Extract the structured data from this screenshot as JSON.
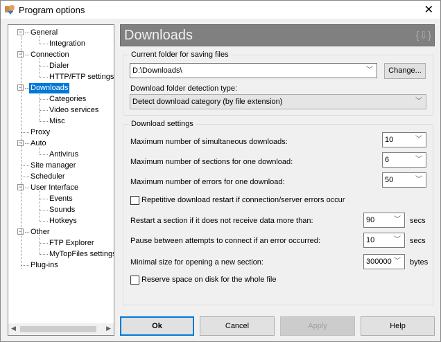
{
  "window": {
    "title": "Program options",
    "close": "✕"
  },
  "tree": [
    {
      "label": "General",
      "level": 0,
      "expander": "−"
    },
    {
      "label": "Integration",
      "level": 1
    },
    {
      "label": "Connection",
      "level": 0,
      "expander": "−"
    },
    {
      "label": "Dialer",
      "level": 1
    },
    {
      "label": "HTTP/FTP settings",
      "level": 1
    },
    {
      "label": "Downloads",
      "level": 0,
      "expander": "−",
      "selected": true
    },
    {
      "label": "Categories",
      "level": 1
    },
    {
      "label": "Video services",
      "level": 1
    },
    {
      "label": "Misc",
      "level": 1
    },
    {
      "label": "Proxy",
      "level": 0
    },
    {
      "label": "Auto",
      "level": 0,
      "expander": "−"
    },
    {
      "label": "Antivirus",
      "level": 1
    },
    {
      "label": "Site manager",
      "level": 0
    },
    {
      "label": "Scheduler",
      "level": 0
    },
    {
      "label": "User Interface",
      "level": 0,
      "expander": "−"
    },
    {
      "label": "Events",
      "level": 1
    },
    {
      "label": "Sounds",
      "level": 1
    },
    {
      "label": "Hotkeys",
      "level": 1
    },
    {
      "label": "Other",
      "level": 0,
      "expander": "−"
    },
    {
      "label": "FTP Explorer",
      "level": 1
    },
    {
      "label": "MyTopFiles settings",
      "level": 1
    },
    {
      "label": "Plug-ins",
      "level": 0
    }
  ],
  "header": {
    "title": "Downloads",
    "icon": "{⇩}"
  },
  "folder_group": {
    "label": "Current folder for saving files",
    "folder_value": "D:\\Downloads\\",
    "change_button": "Change...",
    "detection_label": "Download folder detection type:",
    "detection_value": "Detect download category (by file extension)"
  },
  "settings_group": {
    "label": "Download settings",
    "max_downloads": {
      "label": "Maximum number of simultaneous downloads:",
      "value": "10"
    },
    "max_sections": {
      "label": "Maximum number of sections for one download:",
      "value": "6"
    },
    "max_errors": {
      "label": "Maximum number of errors for one download:",
      "value": "50"
    },
    "repetitive_restart": {
      "label": "Repetitive download restart if connection/server errors occur",
      "checked": false
    },
    "restart_section": {
      "label": "Restart a section if it does not receive data more than:",
      "value": "90",
      "unit": "secs"
    },
    "pause_between": {
      "label": "Pause between attempts to connect if an error occurred:",
      "value": "10",
      "unit": "secs"
    },
    "min_size": {
      "label": "Minimal size for opening a new section:",
      "value": "300000",
      "unit": "bytes"
    },
    "reserve_space": {
      "label": "Reserve space on disk for the whole file",
      "checked": false
    }
  },
  "buttons": {
    "ok": "Ok",
    "cancel": "Cancel",
    "apply": "Apply",
    "help": "Help"
  },
  "colors": {
    "selection": "#0078d7",
    "header_bg": "#808080"
  }
}
